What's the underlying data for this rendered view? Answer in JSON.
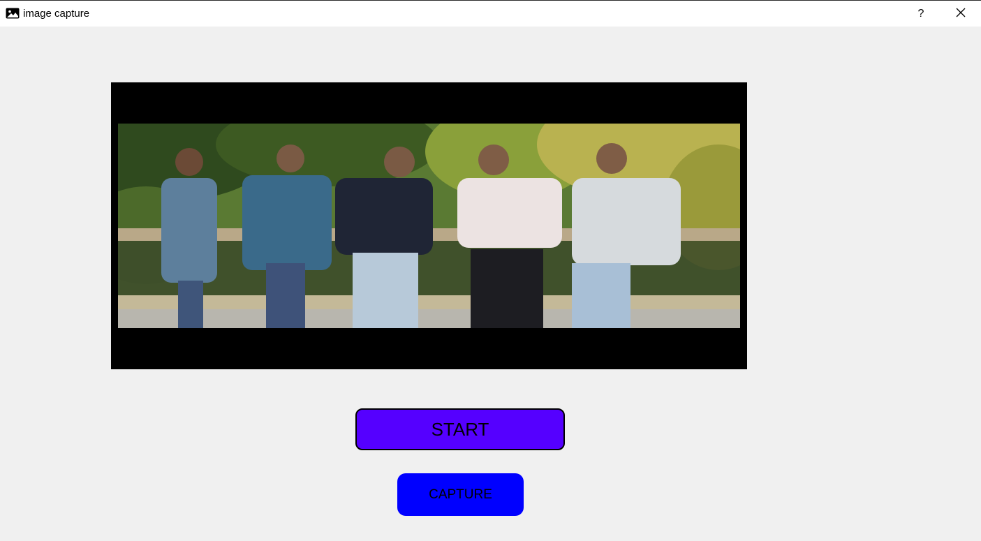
{
  "window": {
    "title": "image capture",
    "help_label": "?",
    "app_icon": "image-icon",
    "close_icon": "close-icon"
  },
  "preview": {
    "photo": "group-of-five-people-outdoors"
  },
  "buttons": {
    "start_label": "START",
    "start_color": "#5500ff",
    "capture_label": "CAPTURE",
    "capture_color": "#0000ff"
  }
}
